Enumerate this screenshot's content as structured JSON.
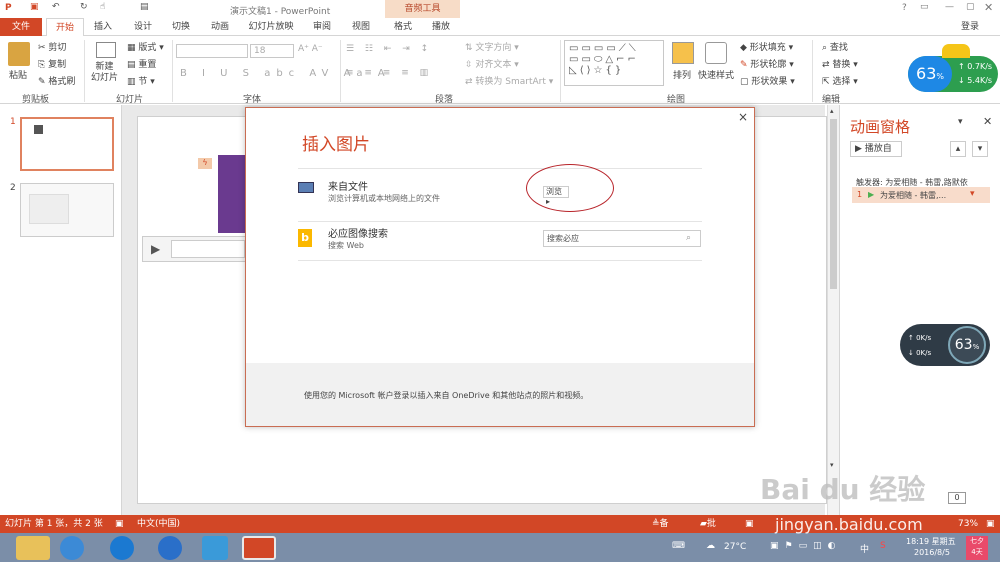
{
  "window": {
    "title": "演示文稿1 - PowerPoint",
    "context_tab_header": "音频工具",
    "help": "?",
    "login": "登录"
  },
  "tabs": [
    "文件",
    "开始",
    "插入",
    "设计",
    "切换",
    "动画",
    "幻灯片放映",
    "审阅",
    "视图",
    "格式",
    "播放"
  ],
  "ribbon": {
    "clipboard": {
      "paste": "粘贴",
      "cut": "剪切",
      "copy": "复制",
      "format_painter": "格式刷",
      "label": "剪贴板"
    },
    "slides": {
      "new_slide": "新建\n幻灯片",
      "layout": "版式",
      "reset": "重置",
      "section": "节",
      "label": "幻灯片"
    },
    "font": {
      "font_size": "18",
      "label": "字体"
    },
    "paragraph": {
      "text_direction": "文字方向",
      "align_text": "对齐文本",
      "smartart": "转换为 SmartArt",
      "label": "段落"
    },
    "drawing": {
      "arrange": "排列",
      "quick_styles": "快速样式",
      "shape_fill": "形状填充",
      "shape_outline": "形状轮廓",
      "shape_effects": "形状效果",
      "label": "绘图"
    },
    "editing": {
      "find": "查找",
      "replace": "替换",
      "select": "选择",
      "label": "编辑"
    }
  },
  "speed_widget": {
    "percent": "63",
    "percent_unit": "%",
    "up": "0.7K/s",
    "down": "5.4K/s"
  },
  "thumbnails": [
    {
      "number": "1"
    },
    {
      "number": "2"
    }
  ],
  "dialog": {
    "title": "插入图片",
    "close": "×",
    "from_file": {
      "title": "来自文件",
      "subtitle": "浏览计算机或本地网络上的文件",
      "browse": "浏览 ▸"
    },
    "bing": {
      "title": "必应图像搜索",
      "subtitle": "搜索 Web",
      "placeholder": "搜索必应"
    },
    "footer": "使用您的 Microsoft 帐户登录以插入来自 OneDrive 和其他站点的照片和视频。"
  },
  "anim_pane": {
    "title": "动画窗格",
    "play_from": "▶ 播放自",
    "trigger": "触发器: 为爱相随 - 韩雷,路默依",
    "item_number": "1",
    "item_label": "为爱相随 - 韩雷,..."
  },
  "side_widget": {
    "up": "0K/s",
    "down": "0K/s",
    "percent": "63",
    "percent_unit": "%"
  },
  "status": {
    "slide_info": "幻灯片 第 1 张，共 2 张",
    "language": "中文(中国)",
    "notes": "备注",
    "comments": "批注",
    "zoom": "73%"
  },
  "watermark": {
    "brand": "Bai  du 经验",
    "url": "jingyan.baidu.com"
  },
  "taskbar": {
    "weather": "27°C",
    "ime": "中",
    "time": "18:19 星期五",
    "date": "2016/8/5",
    "weekday": "七夕\n4天"
  },
  "colors": {
    "accent": "#d24726",
    "dialog_border": "#c96d53",
    "taskbar": "#7b8ea8"
  }
}
